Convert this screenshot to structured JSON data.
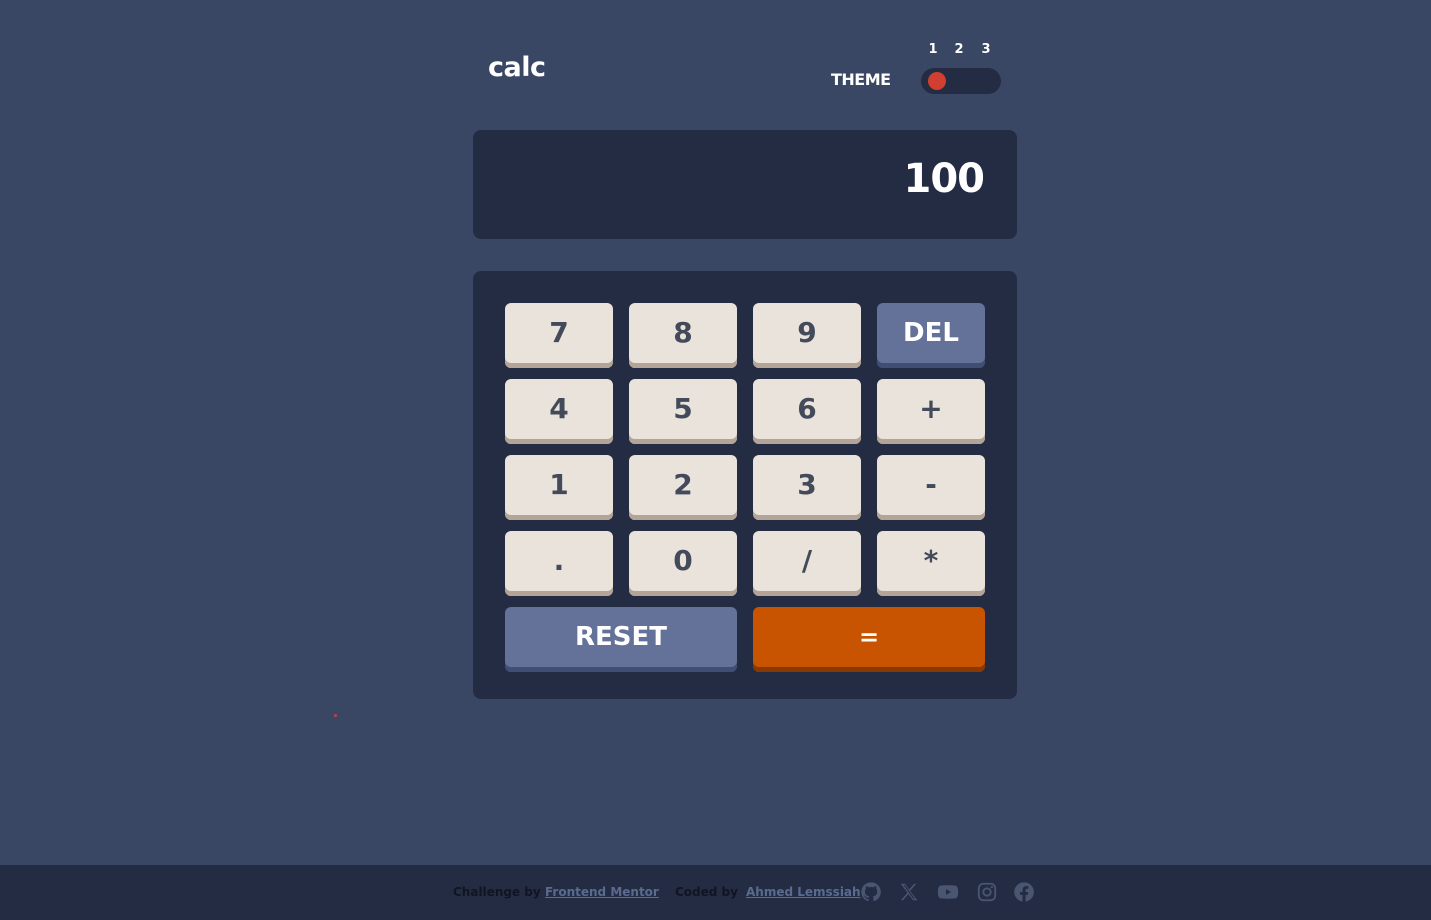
{
  "header": {
    "logo": "calc",
    "theme_label": "THEME",
    "theme_numbers": [
      "1",
      "2",
      "3"
    ],
    "active_theme": "1"
  },
  "screen": {
    "value": "100"
  },
  "keypad": {
    "keys": [
      "7",
      "8",
      "9",
      "DEL",
      "4",
      "5",
      "6",
      "+",
      "1",
      "2",
      "3",
      "-",
      ".",
      "0",
      "/",
      "*",
      "RESET",
      "="
    ]
  },
  "footer": {
    "challenge_label": "Challenge by",
    "challenge_link": "Frontend Mentor",
    "coded_label": "Coded by",
    "coded_link": "Ahmed Lemssiah",
    "social_icons": [
      "github-icon",
      "x-icon",
      "youtube-icon",
      "instagram-icon",
      "facebook-icon"
    ]
  },
  "colors": {
    "main_bg": "#3a4764",
    "panel_bg": "#232c43",
    "key_bg": "#eae3dc",
    "key_text": "#434a59",
    "key_dark": "#647198",
    "accent": "#c85402",
    "toggle_knob": "#d03f2f",
    "footer_link": "#5a6b8f"
  }
}
